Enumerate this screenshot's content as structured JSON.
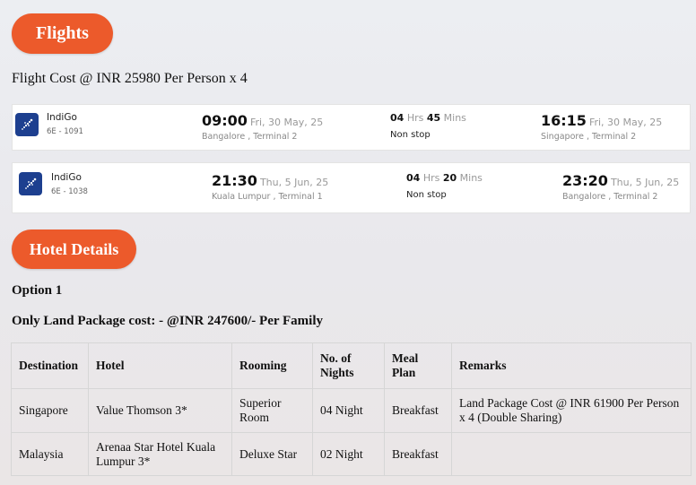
{
  "flights_heading": "Flights",
  "flight_cost": "Flight Cost @ INR 25980 Per Person x 4",
  "flights": [
    {
      "airline": "IndiGo",
      "flight_no": "6E - 1091",
      "dep_time": "09:00",
      "dep_date": "Fri, 30 May, 25",
      "dep_place": "Bangalore , Terminal 2",
      "dur_h": "04",
      "dur_h_unit": "Hrs",
      "dur_m": "45",
      "dur_m_unit": "Mins",
      "stops": "Non stop",
      "arr_time": "16:15",
      "arr_date": "Fri, 30 May, 25",
      "arr_place": "Singapore , Terminal 2"
    },
    {
      "airline": "IndiGo",
      "flight_no": "6E - 1038",
      "dep_time": "21:30",
      "dep_date": "Thu, 5 Jun, 25",
      "dep_place": "Kuala Lumpur , Terminal 1",
      "dur_h": "04",
      "dur_h_unit": "Hrs",
      "dur_m": "20",
      "dur_m_unit": "Mins",
      "stops": "Non stop",
      "arr_time": "23:20",
      "arr_date": "Thu, 5 Jun, 25",
      "arr_place": "Bangalore , Terminal 2"
    }
  ],
  "hotel_heading": "Hotel Details",
  "option_label": "Option 1",
  "land_package": "Only Land Package cost: - @INR 247600/- Per Family",
  "hotel_table": {
    "headers": [
      "Destination",
      "Hotel",
      "Rooming",
      "No. of Nights",
      "Meal Plan",
      "Remarks"
    ],
    "rows": [
      [
        "Singapore",
        "Value Thomson 3*",
        "Superior Room",
        "04 Night",
        "Breakfast",
        "Land Package Cost @ INR 61900 Per Person x 4 (Double Sharing)"
      ],
      [
        "Malaysia",
        "Arenaa Star Hotel Kuala Lumpur 3*",
        "Deluxe Star",
        "02 Night",
        "Breakfast",
        ""
      ]
    ]
  },
  "colors": {
    "accent": "#ec5a2b",
    "airline_logo": "#1d3f8f"
  },
  "icons": {
    "airline_logo": "indigo-logo-icon"
  }
}
